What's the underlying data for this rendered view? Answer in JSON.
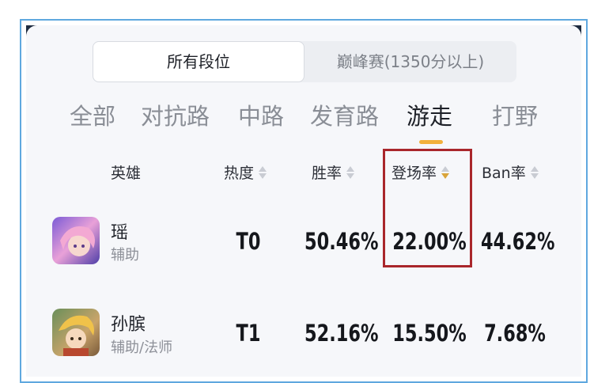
{
  "segment": {
    "all_ranks": "所有段位",
    "peak": "巅峰赛(1350分以上)"
  },
  "tabs": [
    {
      "label": "全部"
    },
    {
      "label": "对抗路"
    },
    {
      "label": "中路"
    },
    {
      "label": "发育路"
    },
    {
      "label": "游走"
    },
    {
      "label": "打野"
    }
  ],
  "active_tab": "游走",
  "columns": {
    "hero": "英雄",
    "heat": "热度",
    "win_rate": "胜率",
    "pick_rate": "登场率",
    "ban_rate": "Ban率"
  },
  "rows": [
    {
      "name": "瑶",
      "role": "辅助",
      "tier": "T0",
      "win": "50.46%",
      "pick": "22.00%",
      "ban": "44.62%"
    },
    {
      "name": "孙膑",
      "role": "辅助/法师",
      "tier": "T1",
      "win": "52.16%",
      "pick": "15.50%",
      "ban": "7.68%"
    }
  ],
  "colors": {
    "accent": "#f2b13c",
    "highlight_box": "#a9262b",
    "frame": "#5fa8df"
  }
}
